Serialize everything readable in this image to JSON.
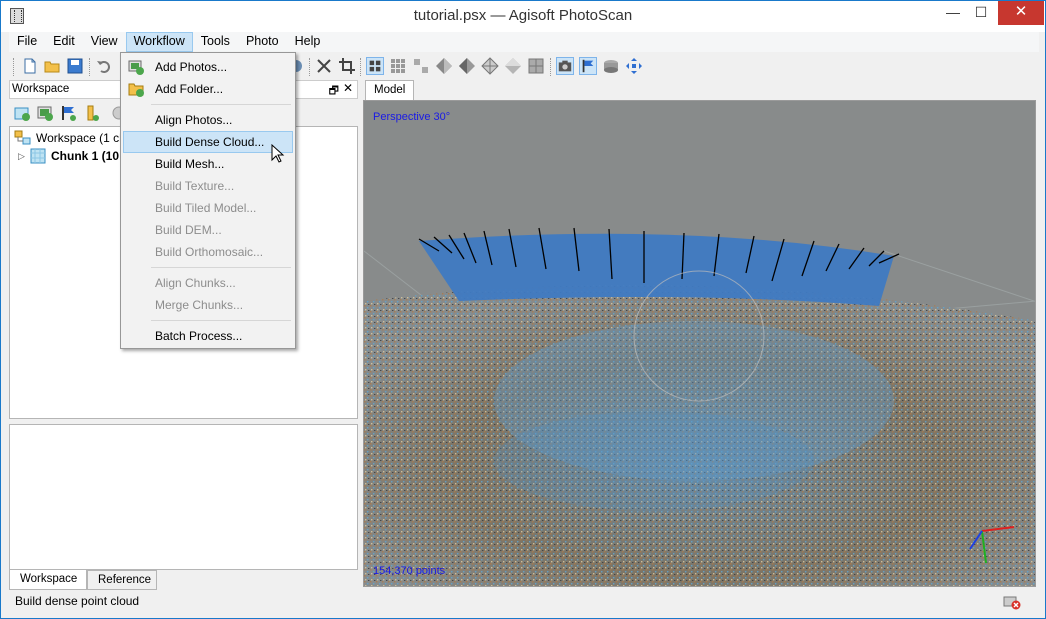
{
  "window": {
    "title": "tutorial.psx — Agisoft PhotoScan",
    "minimize": "—",
    "maximize": "☐",
    "close": "✕"
  },
  "menubar": {
    "items": [
      "File",
      "Edit",
      "View",
      "Workflow",
      "Tools",
      "Photo",
      "Help"
    ],
    "active": "Workflow"
  },
  "workflow_menu": {
    "items": [
      {
        "label": "Add Photos...",
        "enabled": true
      },
      {
        "label": "Add Folder...",
        "enabled": true
      },
      {
        "label": "Align Photos...",
        "enabled": true
      },
      {
        "label": "Build Dense Cloud...",
        "enabled": true,
        "hover": true
      },
      {
        "label": "Build Mesh...",
        "enabled": true
      },
      {
        "label": "Build Texture...",
        "enabled": false
      },
      {
        "label": "Build Tiled Model...",
        "enabled": false
      },
      {
        "label": "Build DEM...",
        "enabled": false
      },
      {
        "label": "Build Orthomosaic...",
        "enabled": false
      },
      {
        "label": "Align Chunks...",
        "enabled": false
      },
      {
        "label": "Merge Chunks...",
        "enabled": false
      },
      {
        "label": "Batch Process...",
        "enabled": true
      }
    ]
  },
  "workspace": {
    "header": "Workspace",
    "pin": "🗗",
    "close": "✕",
    "tree": {
      "root": "Workspace (1 ch",
      "chunk": "Chunk 1 (10"
    },
    "tabs": [
      "Workspace",
      "Reference"
    ]
  },
  "model": {
    "tab": "Model",
    "projection": "Perspective 30°",
    "points": "154,370 points"
  },
  "status": {
    "text": "Build dense point cloud"
  },
  "colors": {
    "accent": "#1979ca",
    "hover": "#cce4f7",
    "viewport_bg": "#888b8b",
    "overlay_text": "#1a1ae6",
    "close_btn": "#c7372f"
  }
}
